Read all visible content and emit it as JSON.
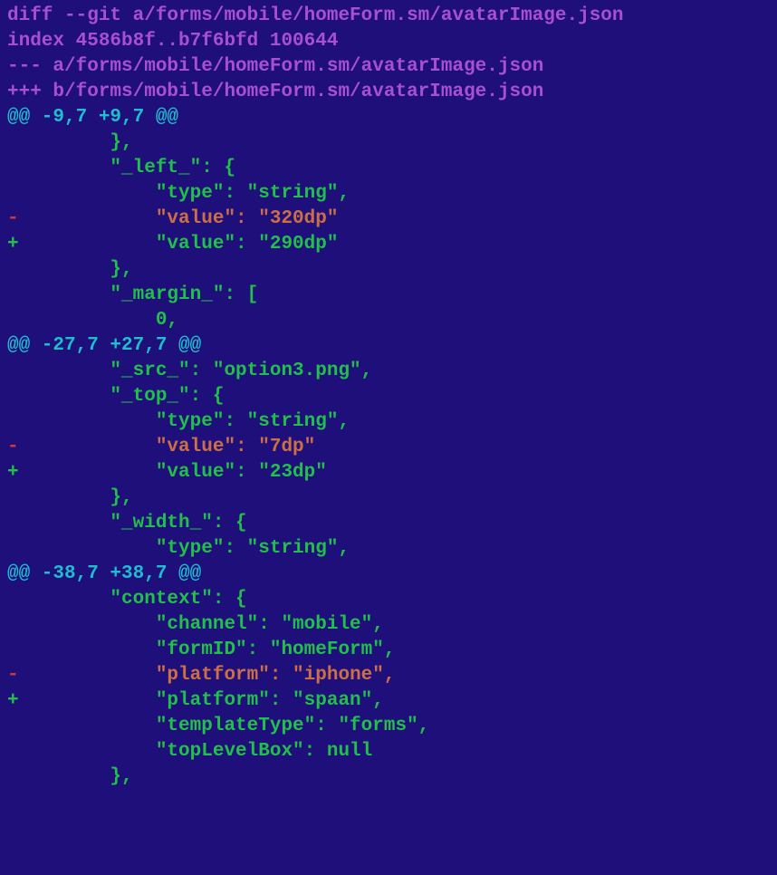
{
  "header": {
    "diff_cmd": "diff --git a/forms/mobile/homeForm.sm/avatarImage.json",
    "index_line": "index 4586b8f..b7f6bfd 100644",
    "old_file": "--- a/forms/mobile/homeForm.sm/avatarImage.json",
    "new_file": "+++ b/forms/mobile/homeForm.sm/avatarImage.json"
  },
  "hunks": [
    {
      "header": "@@ -9,7 +9,7 @@",
      "lines": [
        {
          "t": "ctx",
          "text": "        },"
        },
        {
          "t": "ctx",
          "text": "        \"_left_\": {"
        },
        {
          "t": "ctx",
          "text": "            \"type\": \"string\","
        },
        {
          "t": "del",
          "text": "            \"value\": \"320dp\""
        },
        {
          "t": "add",
          "text": "            \"value\": \"290dp\""
        },
        {
          "t": "ctx",
          "text": "        },"
        },
        {
          "t": "ctx",
          "text": "        \"_margin_\": ["
        },
        {
          "t": "ctx",
          "text": "            0,"
        }
      ]
    },
    {
      "header": "@@ -27,7 +27,7 @@",
      "lines": [
        {
          "t": "ctx",
          "text": "        \"_src_\": \"option3.png\","
        },
        {
          "t": "ctx",
          "text": "        \"_top_\": {"
        },
        {
          "t": "ctx",
          "text": "            \"type\": \"string\","
        },
        {
          "t": "del",
          "text": "            \"value\": \"7dp\""
        },
        {
          "t": "add",
          "text": "            \"value\": \"23dp\""
        },
        {
          "t": "ctx",
          "text": "        },"
        },
        {
          "t": "ctx",
          "text": "        \"_width_\": {"
        },
        {
          "t": "ctx",
          "text": "            \"type\": \"string\","
        }
      ]
    },
    {
      "header": "@@ -38,7 +38,7 @@",
      "lines": [
        {
          "t": "ctx",
          "text": "        \"context\": {"
        },
        {
          "t": "ctx",
          "text": "            \"channel\": \"mobile\","
        },
        {
          "t": "ctx",
          "text": "            \"formID\": \"homeForm\","
        },
        {
          "t": "del",
          "text": "            \"platform\": \"iphone\","
        },
        {
          "t": "add",
          "text": "            \"platform\": \"spaan\","
        },
        {
          "t": "ctx",
          "text": "            \"templateType\": \"forms\","
        },
        {
          "t": "ctx",
          "text": "            \"topLevelBox\": null"
        },
        {
          "t": "ctx",
          "text": "        },"
        }
      ]
    }
  ]
}
